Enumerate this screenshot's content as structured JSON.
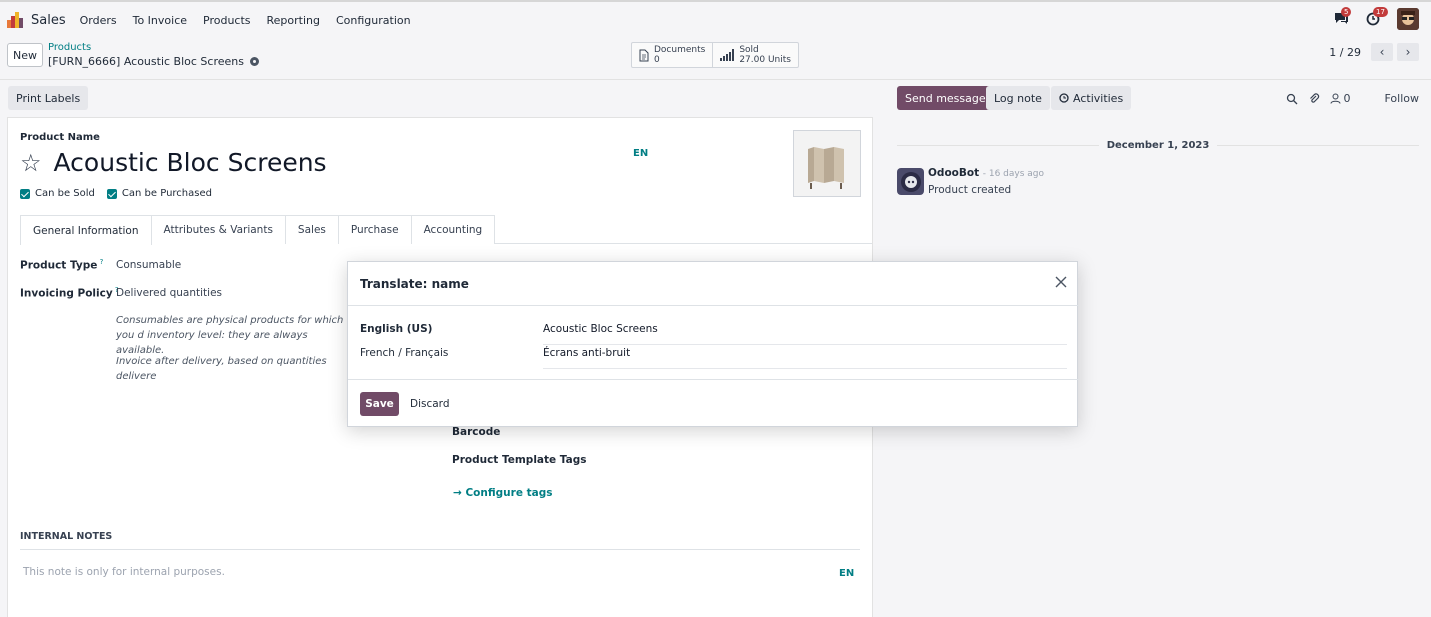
{
  "navbar": {
    "app_name": "Sales",
    "menu": [
      "Orders",
      "To Invoice",
      "Products",
      "Reporting",
      "Configuration"
    ],
    "messages_badge": "5",
    "activities_badge": "17"
  },
  "control": {
    "new_label": "New",
    "breadcrumb_parent": "Products",
    "breadcrumb_current": "[FURN_6666] Acoustic Bloc Screens",
    "smart_buttons": [
      {
        "label": "Documents",
        "value": "0"
      },
      {
        "label": "Sold",
        "value": "27.00 Units"
      }
    ],
    "pager": "1 / 29"
  },
  "actions": {
    "print_labels": "Print Labels",
    "send_message": "Send message",
    "log_note": "Log note",
    "activities": "Activities",
    "followers_count": "0",
    "follow": "Follow"
  },
  "form": {
    "product_name_label": "Product Name",
    "product_name": "Acoustic Bloc Screens",
    "lang_tag": "EN",
    "can_be_sold": "Can be Sold",
    "can_be_purchased": "Can be Purchased",
    "tabs": [
      "General Information",
      "Attributes & Variants",
      "Sales",
      "Purchase",
      "Accounting"
    ],
    "product_type_label": "Product Type",
    "product_type": "Consumable",
    "invoicing_policy_label": "Invoicing Policy",
    "invoicing_policy": "Delivered quantities",
    "hint_consumable": "Consumables are physical products for which you d inventory level: they are always available.",
    "hint_invoice": "Invoice after delivery, based on quantities delivere",
    "barcode_label": "Barcode",
    "tags_label": "Product Template Tags",
    "configure_tags": "Configure tags",
    "internal_notes_header": "INTERNAL NOTES",
    "notes_placeholder": "This note is only for internal purposes.",
    "notes_lang_tag": "EN"
  },
  "chatter": {
    "date": "December 1, 2023",
    "author": "OdooBot",
    "time": "- 16 days ago",
    "body": "Product created"
  },
  "modal": {
    "title": "Translate: name",
    "rows": [
      {
        "lang": "English (US)",
        "value": "Acoustic Bloc Screens"
      },
      {
        "lang": "French / Français",
        "value": "Écrans anti-bruit"
      }
    ],
    "save": "Save",
    "discard": "Discard"
  },
  "colors": {
    "brand": "#714b67",
    "link": "#017e84",
    "badge": "#c23b3b"
  }
}
